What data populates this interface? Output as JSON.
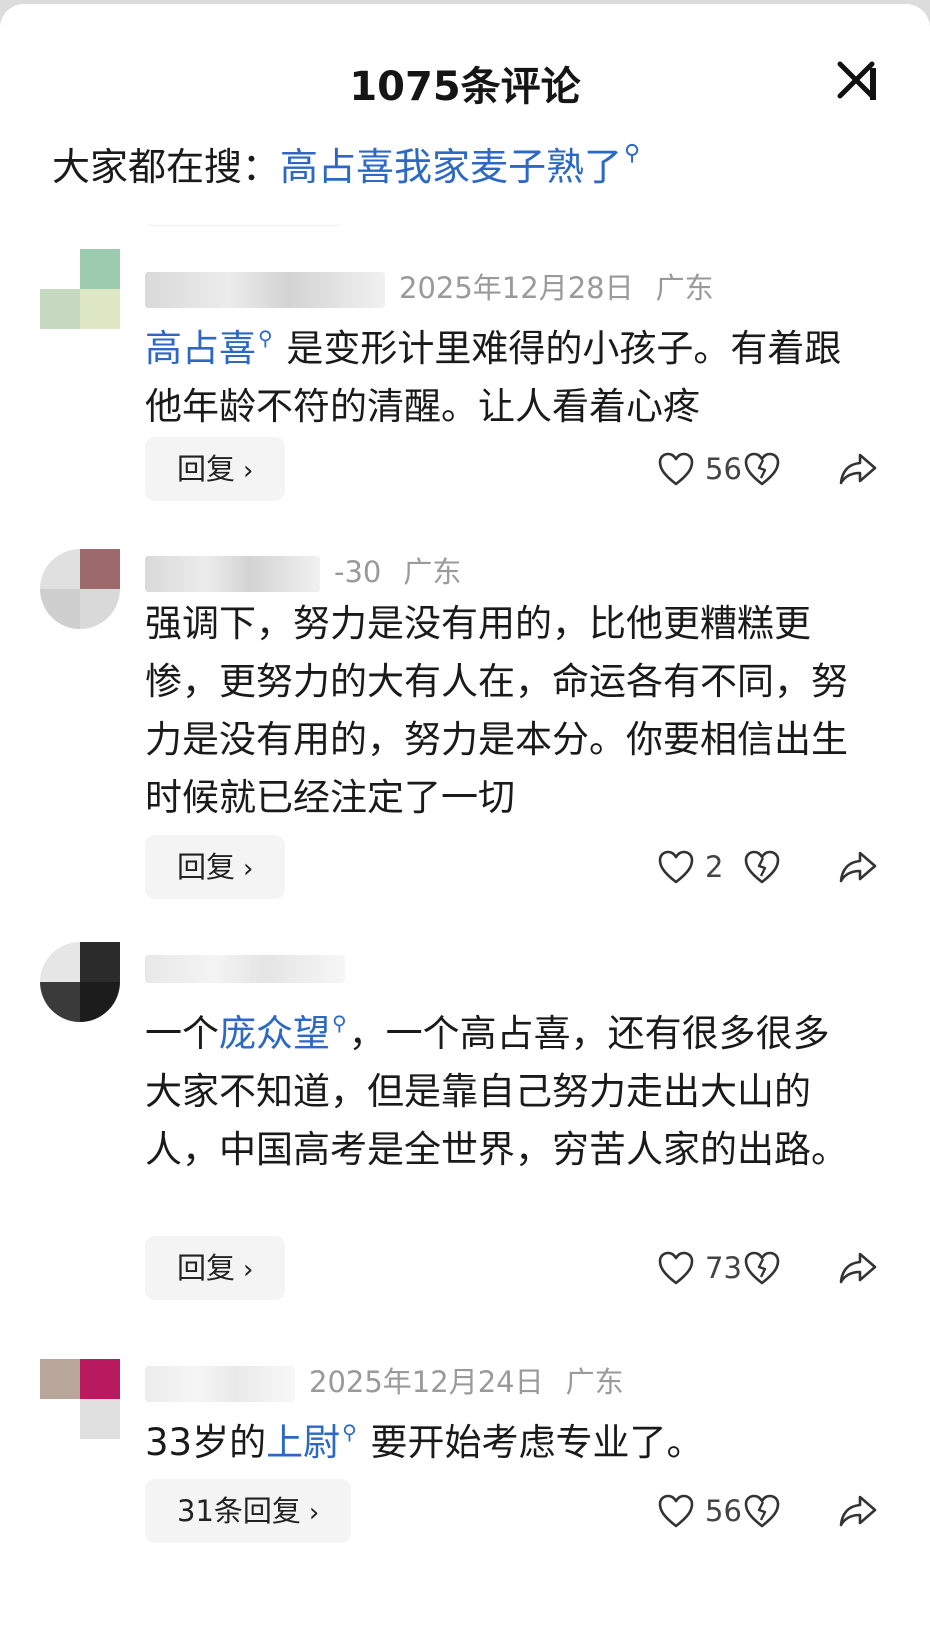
{
  "header": {
    "title": "1075条评论"
  },
  "search_hint": {
    "prefix": "大家都在搜：",
    "term": "高占喜我家麦子熟了"
  },
  "comments": [
    {
      "date": "2025年12月28日",
      "location": "广东",
      "link": "高占喜",
      "text": "是变形计里难得的小孩子。有着跟他年龄不符的清醒。让人看着心疼",
      "reply_label": "回复",
      "likes": "56",
      "avatar_colors": [
        "#ffffff",
        "#9ccbb0",
        "#c4d9c0",
        "#dfe8c4"
      ]
    },
    {
      "date": "-30",
      "location": "广东",
      "text": "强调下，努力是没有用的，比他更糟糕更惨，更努力的大有人在，命运各有不同，努力是没有用的，努力是本分。你要相信出生时候就已经注定了一切",
      "reply_label": "回复",
      "likes": "2",
      "avatar_colors": [
        "#e0e0e0",
        "#9c6a6a",
        "#cfcfcf",
        "#d9d9d9"
      ]
    },
    {
      "date": "",
      "location": "",
      "text_before": "一个",
      "link": "庞众望",
      "text_after": "，一个高占喜，还有很多很多大家不知道，但是靠自己努力走出大山的人，中国高考是全世界，穷苦人家的出路。",
      "reply_label": "回复",
      "likes": "73",
      "avatar_colors": [
        "#e6e6e6",
        "#2b2b2b",
        "#3a3a3a",
        "#1c1c1c"
      ]
    },
    {
      "date": "2025年12月24日",
      "location": "广东",
      "text_before": "33岁的",
      "link": "上尉",
      "text_after": "要开始考虑专业了。",
      "reply_label": "31条回复",
      "likes": "56",
      "avatar_colors": [
        "#b9a79b",
        "#b8195f",
        "#ffffff",
        "#e0e0e0"
      ]
    }
  ],
  "icons": {
    "close": "close-icon",
    "like": "heart-icon",
    "dislike": "broken-heart-icon",
    "share": "share-icon",
    "search_mark": "search-icon",
    "chevron": "chevron-right-icon"
  },
  "colors": {
    "link": "#2c68c4",
    "text": "#1a1a1a",
    "meta": "#9a9a9a",
    "button_bg": "#f4f4f4"
  }
}
